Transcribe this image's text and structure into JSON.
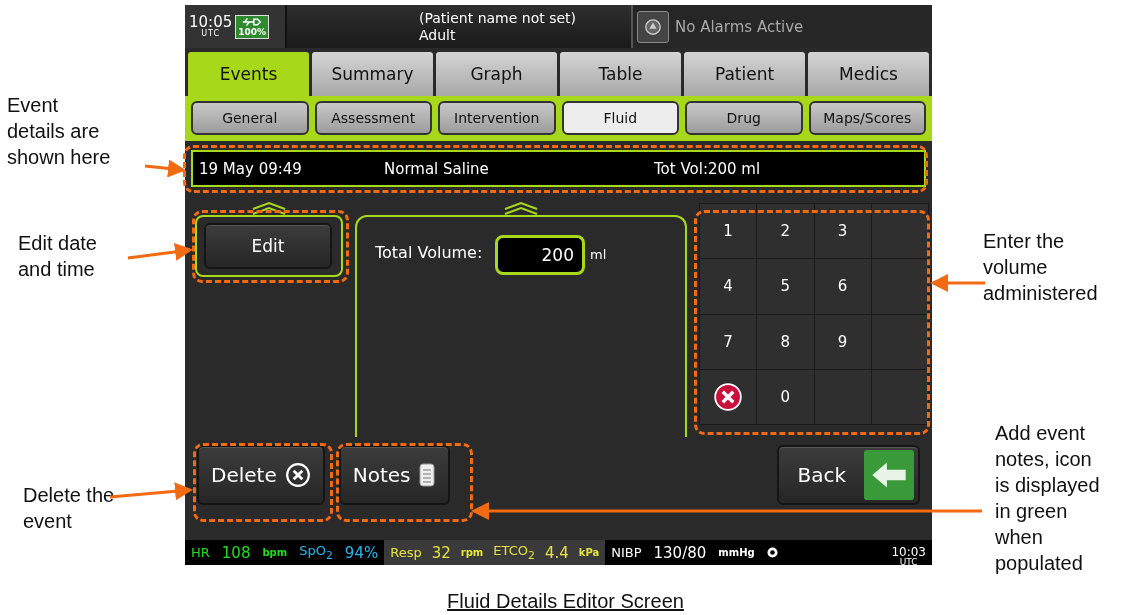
{
  "top_bar": {
    "clock": "10:05",
    "clock_zone": "UTC",
    "battery": "100%",
    "patient_name": "(Patient name not set)",
    "patient_type": "Adult",
    "alarm_status": "No Alarms Active"
  },
  "tabs": [
    {
      "label": "Events",
      "selected": true
    },
    {
      "label": "Summary",
      "selected": false
    },
    {
      "label": "Graph",
      "selected": false
    },
    {
      "label": "Table",
      "selected": false
    },
    {
      "label": "Patient",
      "selected": false
    },
    {
      "label": "Medics",
      "selected": false
    }
  ],
  "subtabs": [
    {
      "label": "General",
      "selected": false
    },
    {
      "label": "Assessment",
      "selected": false
    },
    {
      "label": "Intervention",
      "selected": false
    },
    {
      "label": "Fluid",
      "selected": true
    },
    {
      "label": "Drug",
      "selected": false
    },
    {
      "label": "Maps/Scores",
      "selected": false
    }
  ],
  "event_details": {
    "time": "19 May 09:49",
    "fluid": "Normal Saline",
    "total": "Tot Vol:200 ml"
  },
  "edit_button": "Edit",
  "volume": {
    "label": "Total Volume:",
    "value": "200",
    "unit": "ml"
  },
  "keypad": [
    {
      "kind": "digit",
      "label": "1"
    },
    {
      "kind": "digit",
      "label": "2"
    },
    {
      "kind": "digit",
      "label": "3"
    },
    {
      "kind": "blank"
    },
    {
      "kind": "digit",
      "label": "4"
    },
    {
      "kind": "digit",
      "label": "5"
    },
    {
      "kind": "digit",
      "label": "6"
    },
    {
      "kind": "blank"
    },
    {
      "kind": "digit",
      "label": "7"
    },
    {
      "kind": "digit",
      "label": "8"
    },
    {
      "kind": "digit",
      "label": "9"
    },
    {
      "kind": "blank"
    },
    {
      "kind": "clear"
    },
    {
      "kind": "digit",
      "label": "0"
    },
    {
      "kind": "blank"
    },
    {
      "kind": "blank"
    }
  ],
  "actions": {
    "delete": "Delete",
    "notes": "Notes",
    "back": "Back"
  },
  "status_bar": [
    {
      "items": [
        {
          "text": "HR",
          "kind": "label",
          "color": "#22dd22"
        },
        {
          "text": "108",
          "kind": "value",
          "color": "#22dd22"
        },
        {
          "text": "bpm",
          "kind": "unit",
          "color": "#22dd22"
        },
        {
          "text": "SpO$_{2}$",
          "kind": "label",
          "color": "#2ab8ee"
        },
        {
          "text": "94%",
          "kind": "value",
          "color": "#2ab8ee"
        }
      ]
    },
    {
      "items": [
        {
          "text": "Resp",
          "kind": "label",
          "color": "#e4e43a"
        },
        {
          "text": "32",
          "kind": "value",
          "color": "#e4e43a"
        },
        {
          "text": "rpm",
          "kind": "unit",
          "color": "#e4e43a"
        },
        {
          "text": "ETCO$_{2}$",
          "kind": "label",
          "color": "#e4e43a"
        },
        {
          "text": "4.4",
          "kind": "value",
          "color": "#e4e43a"
        },
        {
          "text": "kPa",
          "kind": "unit",
          "color": "#e4e43a"
        }
      ]
    },
    {
      "items": [
        {
          "text": "NIBP",
          "kind": "label",
          "color": "#ffffff"
        },
        {
          "text": "130/80",
          "kind": "value",
          "color": "#ffffff"
        },
        {
          "text": "mmHg",
          "kind": "unit",
          "color": "#ffffff"
        }
      ]
    }
  ],
  "status_time": "10:03",
  "status_zone": "UTC",
  "annotations": [
    {
      "text": "Event details are shown here"
    },
    {
      "text": "Edit date and time"
    },
    {
      "text": "Delete the event"
    },
    {
      "text": "Enter the volume administered"
    },
    {
      "text": "Add event notes, icon is displayed in green when populated"
    }
  ],
  "caption": "Fluid Details Editor Screen"
}
